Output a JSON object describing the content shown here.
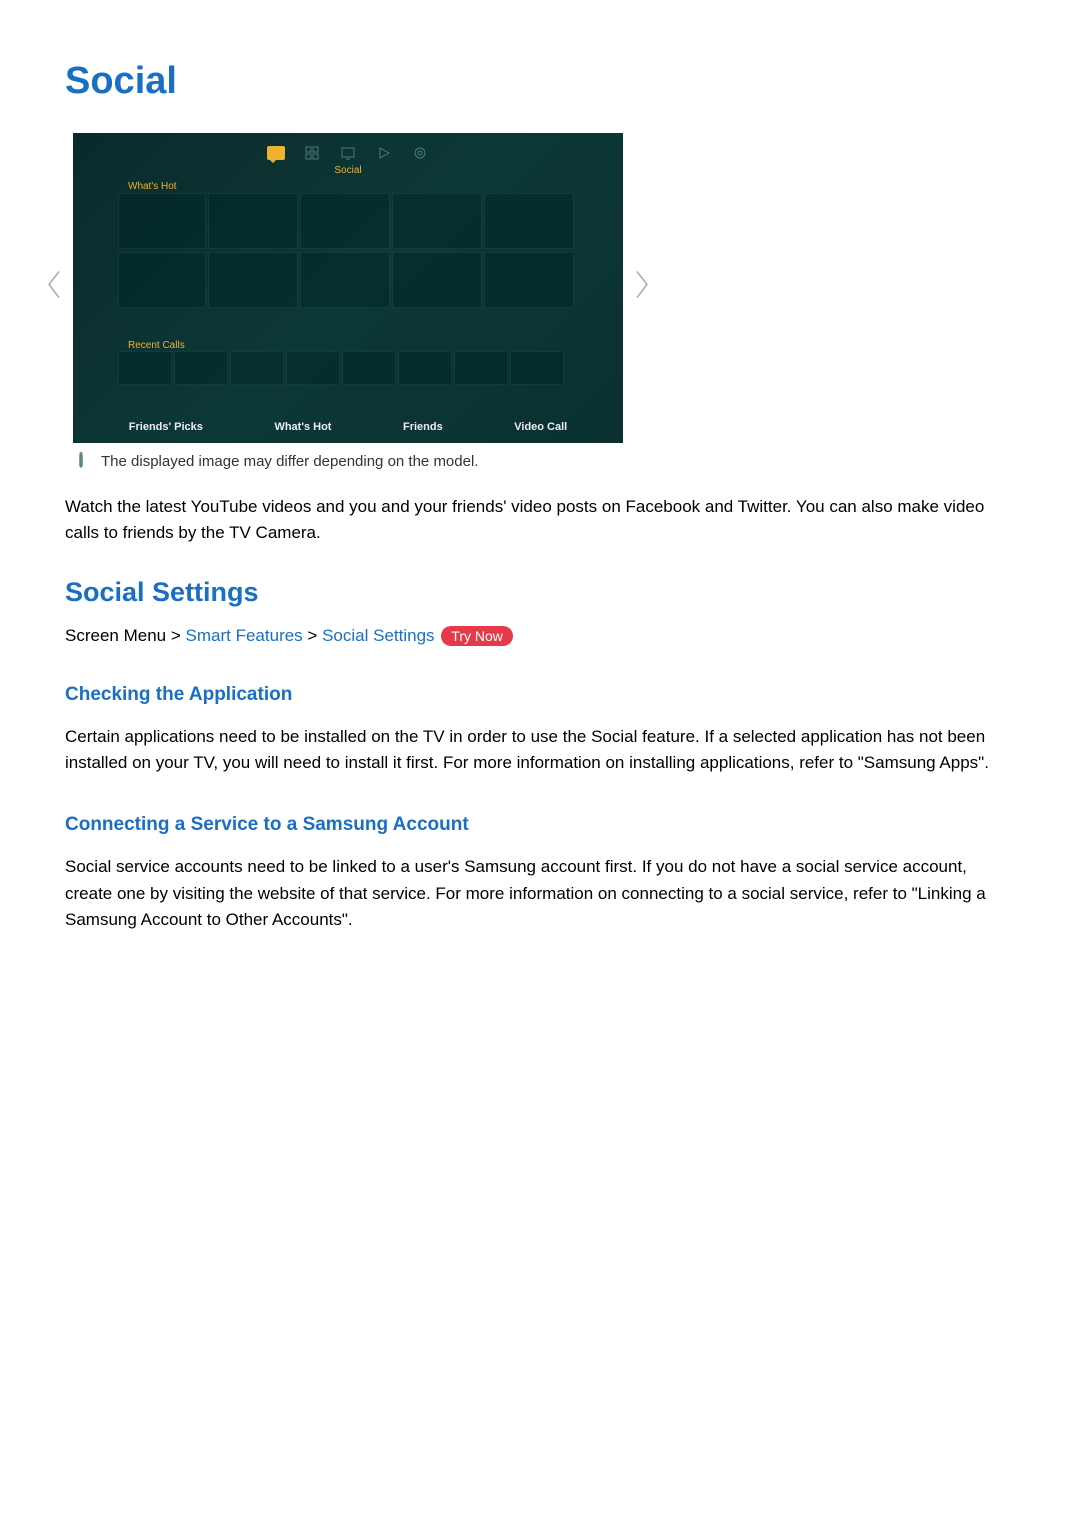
{
  "title": "Social",
  "tv": {
    "nav_active_label": "Social",
    "section_whats_hot": "What's Hot",
    "section_recent_calls": "Recent Calls",
    "tabs": [
      "Friends' Picks",
      "What's Hot",
      "Friends",
      "Video Call"
    ]
  },
  "note": "The displayed image may differ depending on the model.",
  "intro_paragraph": "Watch the latest YouTube videos and you and your friends' video posts on Facebook and Twitter. You can also make video calls to friends by the TV Camera.",
  "social_settings_heading": "Social Settings",
  "breadcrumb": {
    "root": "Screen Menu",
    "sep": ">",
    "item1": "Smart Features",
    "item2": "Social Settings",
    "try_now": "Try Now"
  },
  "checking_heading": "Checking the Application",
  "checking_paragraph": "Certain applications need to be installed on the TV in order to use the Social feature. If a selected application has not been installed on your TV, you will need to install it first. For more information on installing applications, refer to \"Samsung Apps\".",
  "connecting_heading": "Connecting a Service to a Samsung Account",
  "connecting_paragraph": "Social service accounts need to be linked to a user's Samsung account first. If you do not have a social service account, create one by visiting the website of that service. For more information on connecting to a social service, refer to \"Linking a Samsung Account to Other Accounts\"."
}
